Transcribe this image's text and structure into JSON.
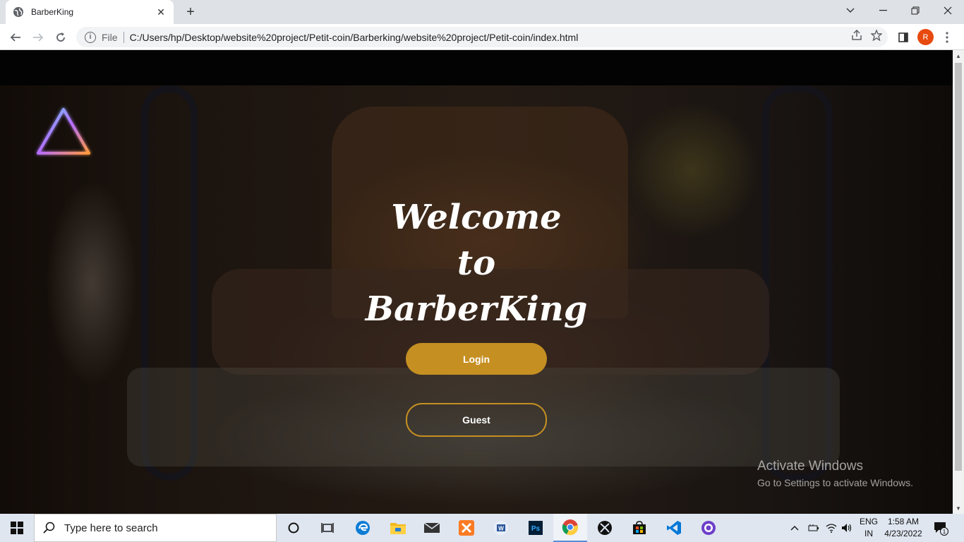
{
  "browser": {
    "tab_title": "BarberKing",
    "url_scheme": "File",
    "url": "C:/Users/hp/Desktop/website%20project/Petit-coin/Barberking/website%20project/Petit-coin/index.html",
    "profile_initial": "R"
  },
  "hero": {
    "welcome_line1": "Welcome",
    "welcome_line2": "to",
    "welcome_line3": "BarberKing",
    "login_label": "Login",
    "guest_label": "Guest",
    "accent_color": "#c58f22"
  },
  "watermark": {
    "title": "Activate Windows",
    "subtitle": "Go to Settings to activate Windows."
  },
  "taskbar": {
    "search_placeholder": "Type here to search",
    "lang_line1": "ENG",
    "lang_line2": "IN",
    "time": "1:58 AM",
    "date": "4/23/2022",
    "notification_count": "1"
  }
}
